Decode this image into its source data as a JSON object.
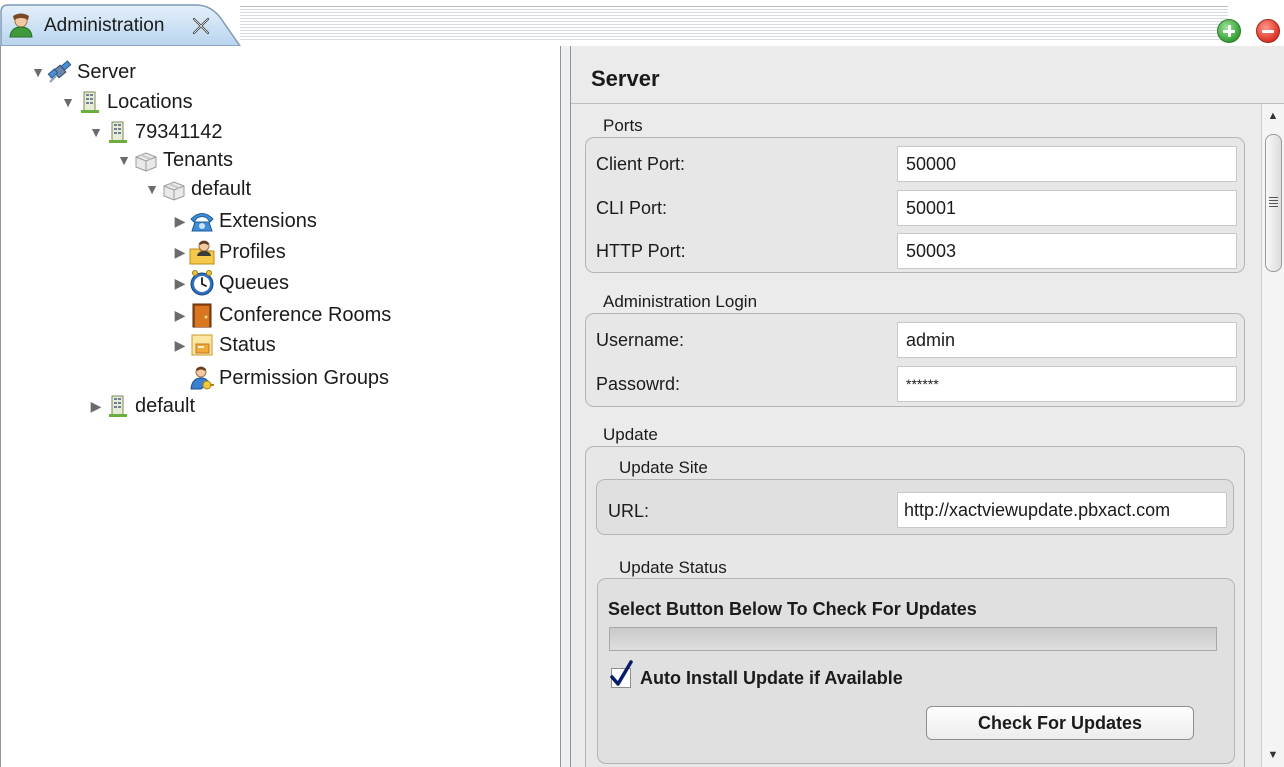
{
  "tab": {
    "label": "Administration",
    "icon": "admin-user-icon"
  },
  "window_buttons": {
    "add_icon": "add-view-icon",
    "remove_icon": "remove-view-icon",
    "add_color": "#3aa43a",
    "remove_color": "#e03a2c"
  },
  "tree": {
    "items": [
      {
        "label": "Server",
        "icon": "server-satellite-icon",
        "expanded": true
      },
      {
        "label": "Locations",
        "icon": "building-icon",
        "expanded": true
      },
      {
        "label": "79341142",
        "icon": "building-icon",
        "expanded": true
      },
      {
        "label": "Tenants",
        "icon": "box-icon",
        "expanded": true
      },
      {
        "label": "default",
        "icon": "box-icon",
        "expanded": true
      },
      {
        "label": "Extensions",
        "icon": "phone-icon",
        "expanded": false
      },
      {
        "label": "Profiles",
        "icon": "profile-folder-icon",
        "expanded": false
      },
      {
        "label": "Queues",
        "icon": "clock-icon",
        "expanded": false
      },
      {
        "label": "Conference Rooms",
        "icon": "door-icon",
        "expanded": false
      },
      {
        "label": "Status",
        "icon": "status-icon",
        "expanded": false
      },
      {
        "label": "Permission Groups",
        "icon": "group-key-icon",
        "expanded": null
      },
      {
        "label": "default",
        "icon": "building-icon",
        "expanded": false
      }
    ]
  },
  "detail": {
    "title": "Server",
    "ports": {
      "group_label": "Ports",
      "client_port_label": "Client Port:",
      "client_port_value": "50000",
      "cli_port_label": "CLI Port:",
      "cli_port_value": "50001",
      "http_port_label": "HTTP Port:",
      "http_port_value": "50003"
    },
    "admin_login": {
      "group_label": "Administration Login",
      "username_label": "Username:",
      "username_value": "admin",
      "password_label": "Passowrd:",
      "password_value": "******"
    },
    "update": {
      "group_label": "Update",
      "site_group_label": "Update Site",
      "url_label": "URL:",
      "url_value": "http://xactviewupdate.pbxact.com",
      "status_group_label": "Update Status",
      "status_heading": "Select Button Below To Check For Updates",
      "progress": 0,
      "auto_install_label": "Auto Install Update if Available",
      "auto_install_checked": true,
      "check_button_label": "Check For Updates"
    }
  }
}
